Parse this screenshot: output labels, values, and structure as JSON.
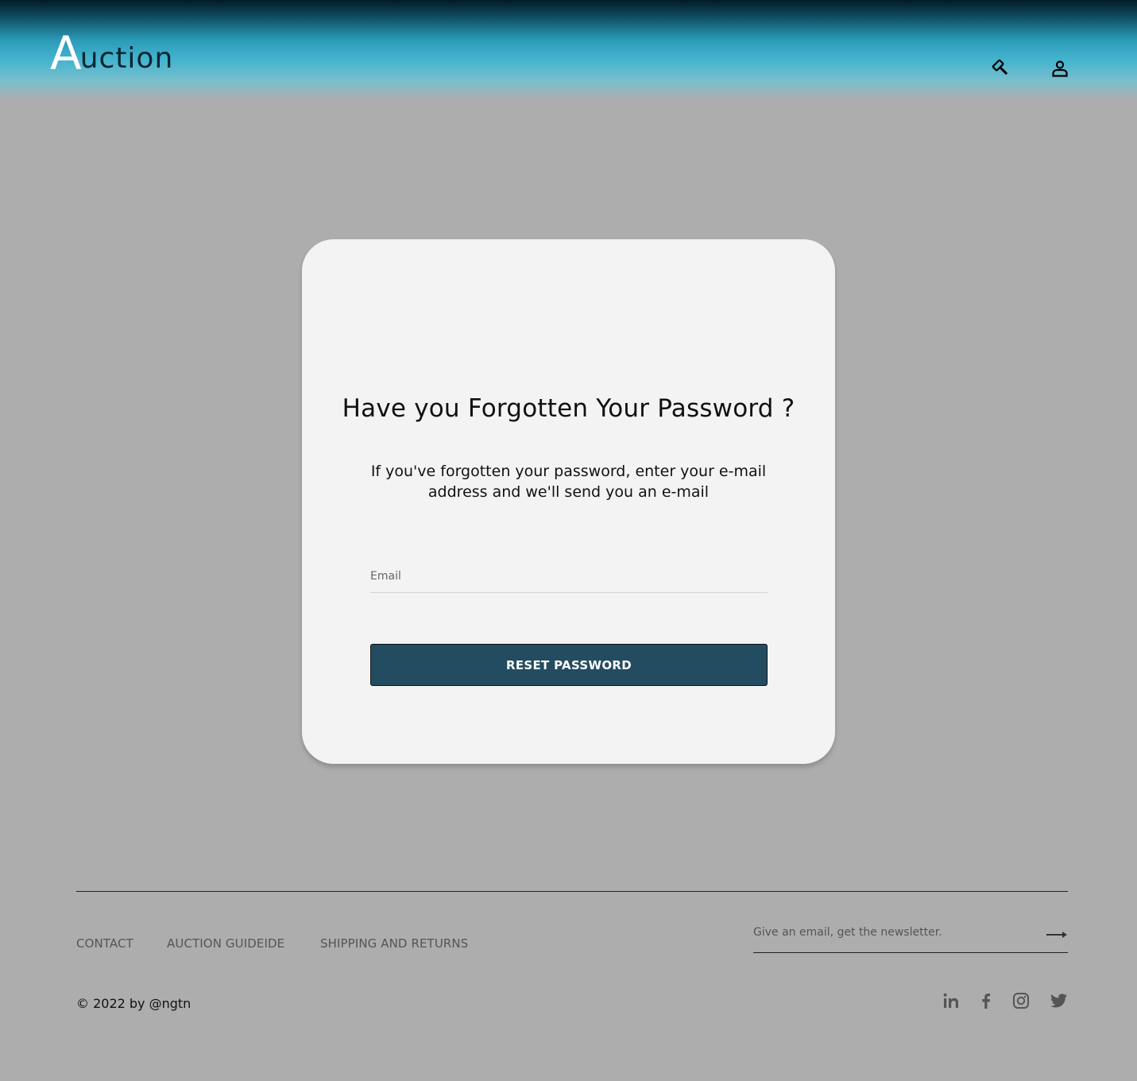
{
  "header": {
    "logo_initial": "A",
    "logo_rest": "uction",
    "icons": [
      "auction-gavel-icon",
      "user-icon"
    ]
  },
  "card": {
    "title": "Have you Forgotten Your Password ?",
    "description": "If you've forgotten your password, enter your e-mail address and we'll send you an e-mail",
    "email_placeholder": "Email",
    "email_value": "",
    "button_label": "RESET PASSWORD"
  },
  "footer": {
    "links": [
      "CONTACT",
      "AUCTION GUIDEIDE",
      "SHIPPING AND RETURNS"
    ],
    "newsletter_placeholder": "Give an email, get the newsletter.",
    "copyright": "© 2022 by @ngtn",
    "social_icons": [
      "linkedin-icon",
      "facebook-icon",
      "instagram-icon",
      "twitter-icon"
    ]
  },
  "colors": {
    "page_background": "#adadad",
    "card_background": "#f3f3f3",
    "button_background": "#244c60",
    "header_accent": "#44b4cf"
  }
}
